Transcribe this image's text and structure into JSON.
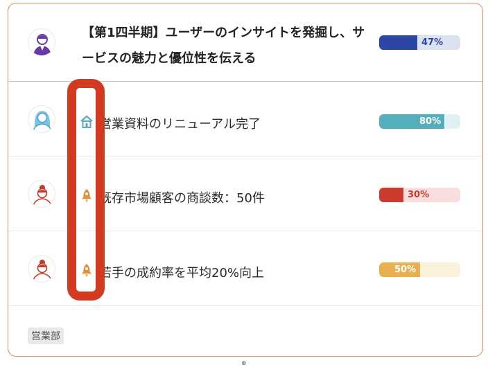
{
  "objectives": [
    {
      "title": "【第1四半期】ユーザーのインサイトを発掘し、サービスの魅力と優位性を伝える",
      "progress": 47,
      "progress_label": "47%",
      "color": "#2b47a6",
      "track": "#dce1ef",
      "avatar": "person-avatar-purple"
    },
    {
      "title": "営業資料のリニューアル完了",
      "progress": 80,
      "progress_label": "80%",
      "color": "#55aebc",
      "track": "#dff1f3",
      "avatar": "person-avatar-blue",
      "icon": "house-icon"
    },
    {
      "title": "既存市場顧客の商談数：50件",
      "progress": 30,
      "progress_label": "30%",
      "color": "#cd3b2f",
      "track": "#f8dedf",
      "avatar": "person-avatar-red",
      "icon": "rocket-icon"
    },
    {
      "title": "若手の成約率を平均20%向上",
      "progress": 50,
      "progress_label": "50%",
      "color": "#e9b04f",
      "track": "#fcf1dc",
      "avatar": "person-avatar-red",
      "icon": "rocket-icon"
    }
  ],
  "footer": {
    "department_tag": "営業部"
  },
  "annotation": {
    "highlight_color": "#d43a20"
  }
}
